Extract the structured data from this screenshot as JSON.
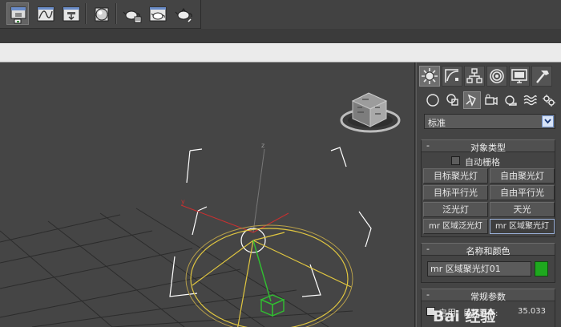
{
  "panel": {
    "dropdown_value": "标准",
    "object_type": {
      "title": "对象类型",
      "autogrid_label": "自动栅格",
      "buttons": [
        "目标聚光灯",
        "自由聚光灯",
        "目标平行光",
        "自由平行光",
        "泛光灯",
        "天光",
        "mr 区域泛光灯",
        "mr 区域聚光灯"
      ]
    },
    "name_color": {
      "title": "名称和颜色",
      "name_value": "mr 区域聚光灯01",
      "color": "#1ea81e"
    },
    "general": {
      "title": "常规参数",
      "enable_label": "启用",
      "target_label": "目标距离:",
      "target_value": "35.033"
    }
  },
  "viewport": {
    "axis_label": "z"
  },
  "watermark": {
    "text": "Bai 经验"
  },
  "colors": {
    "accent_yellow": "#e0c640",
    "light_green": "#30c030",
    "axis_red": "#c83030"
  }
}
